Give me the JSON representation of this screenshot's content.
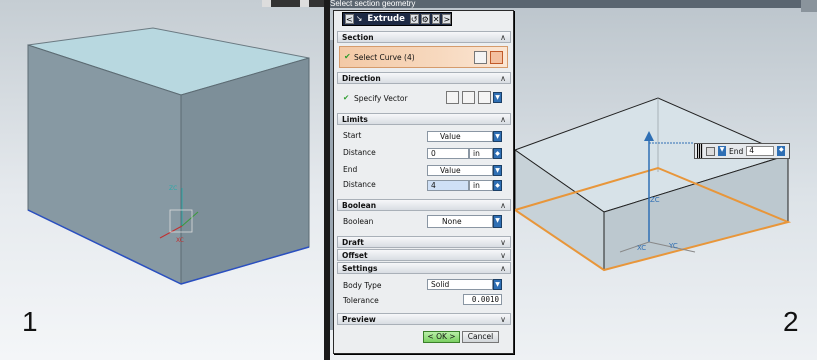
{
  "top": {
    "title": "Select section geometry"
  },
  "panels": {
    "left_label": "1",
    "right_label": "2"
  },
  "dialog": {
    "title": "Extrude",
    "title_icons": [
      "undo-icon",
      "gear-icon",
      "close-icon"
    ],
    "sections": {
      "section": {
        "header": "Section",
        "select_curve": "Select Curve (4)"
      },
      "direction": {
        "header": "Direction",
        "specify_vector": "Specify Vector"
      },
      "limits": {
        "header": "Limits",
        "start_label": "Start",
        "start_value": "Value",
        "distance_label": "Distance",
        "start_distance": "0",
        "start_unit": "in",
        "end_label": "End",
        "end_value": "Value",
        "end_distance_label": "Distance",
        "end_distance": "4",
        "end_unit": "in"
      },
      "boolean": {
        "header": "Boolean",
        "label": "Boolean",
        "value": "None"
      },
      "draft": {
        "header": "Draft"
      },
      "offset": {
        "header": "Offset"
      },
      "settings": {
        "header": "Settings",
        "body_type_label": "Body Type",
        "body_type_value": "Solid",
        "tolerance_label": "Tolerance",
        "tolerance_value": "0.0010"
      },
      "preview": {
        "header": "Preview"
      }
    },
    "buttons": {
      "ok": "< OK >",
      "cancel": "Cancel"
    }
  },
  "viewport": {
    "end_label": "End",
    "end_value": "4",
    "axis_labels": {
      "zc": "ZC",
      "xc": "XC",
      "yc": "YC",
      "zc_left": "ZC",
      "xc_left": "XC"
    }
  },
  "colors": {
    "accent_orange": "#e8963a",
    "dialog_title_bg": "#1e2a44",
    "arrow_blue": "#2f6fb4"
  }
}
